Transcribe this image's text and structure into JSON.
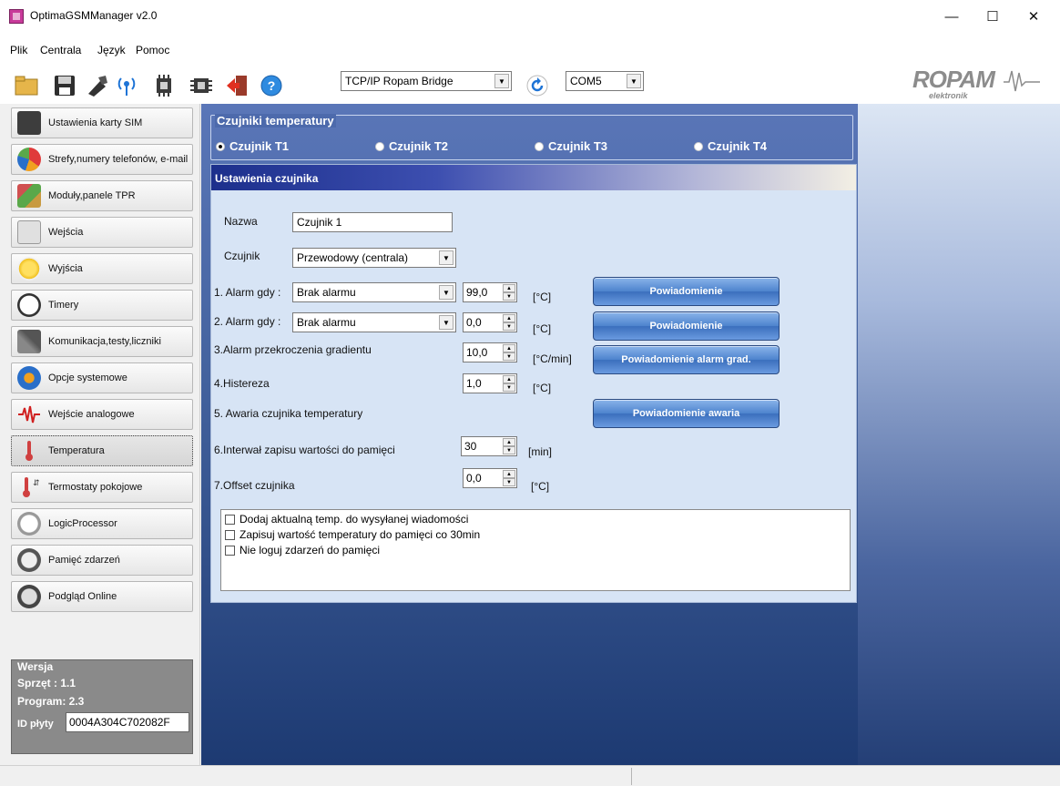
{
  "window": {
    "title": "OptimaGSMManager v2.0"
  },
  "menu": [
    {
      "label": "Plik"
    },
    {
      "label": "Centrala"
    },
    {
      "label": "Język"
    },
    {
      "label": "Pomoc"
    }
  ],
  "toolbar": {
    "connection": "TCP/IP Ropam Bridge",
    "port": "COM5",
    "logo_text": "ROPAM elektronik",
    "icons": [
      "folder-icon",
      "save-icon",
      "tool-icon",
      "wireless-icon",
      "chip-read-icon",
      "chip-write-icon",
      "exit-icon",
      "help-icon",
      "refresh-icon"
    ]
  },
  "sidebar": {
    "items": [
      {
        "label": "Ustawienia karty SIM",
        "icon": "sim-card-icon",
        "color": "#3d3d3d"
      },
      {
        "label": "Strefy,numery telefonów, e-mail",
        "icon": "pie-chart-icon",
        "color": "#e03a3a"
      },
      {
        "label": "Moduły,panele TPR",
        "icon": "modules-icon",
        "color": "#5aa84a"
      },
      {
        "label": "Wejścia",
        "icon": "door-icon",
        "color": "#b5b5b5"
      },
      {
        "label": "Wyjścia",
        "icon": "bulb-icon",
        "color": "#f0c020"
      },
      {
        "label": "Timery",
        "icon": "clock-icon",
        "color": "#404040"
      },
      {
        "label": "Komunikacja,testy,liczniki",
        "icon": "tools-icon",
        "color": "#888"
      },
      {
        "label": "Opcje systemowe",
        "icon": "gears-icon",
        "color": "#2a6fc9"
      },
      {
        "label": "Wejście analogowe",
        "icon": "wave-icon",
        "color": "#d02020"
      },
      {
        "label": "Temperatura",
        "icon": "thermometer-icon",
        "color": "#d04040"
      },
      {
        "label": "Termostaty pokojowe",
        "icon": "thermostat-icon",
        "color": "#d04040"
      },
      {
        "label": "LogicProcessor",
        "icon": "logic-icon",
        "color": "#777"
      },
      {
        "label": "Pamięć zdarzeń",
        "icon": "event-memory-icon",
        "color": "#555"
      },
      {
        "label": "Podgląd Online",
        "icon": "online-preview-icon",
        "color": "#555"
      }
    ],
    "active_index": 9,
    "version": {
      "legend": "Wersja",
      "hardware": "Sprzęt : 1.1",
      "program": "Program: 2.3",
      "id_label": "ID płyty",
      "id_value": "0004A304C702082F"
    }
  },
  "sensors": {
    "legend": "Czujniki temperatury",
    "options": [
      "Czujnik T1",
      "Czujnik T2",
      "Czujnik T3",
      "Czujnik T4"
    ],
    "selected": 0
  },
  "settings": {
    "header": "Ustawienia czujnika",
    "name_label": "Nazwa",
    "name_value": "Czujnik 1",
    "sensor_label": "Czujnik",
    "sensor_value": "Przewodowy (centrala)",
    "alarm1_label": "1. Alarm gdy :",
    "alarm1_value": "Brak alarmu",
    "alarm1_temp": "99,0",
    "alarm1_unit": "[°C]",
    "alarm2_label": "2. Alarm gdy :",
    "alarm2_value": "Brak alarmu",
    "alarm2_temp": "0,0",
    "alarm2_unit": "[°C]",
    "gradient_label": "3.Alarm przekroczenia gradientu",
    "gradient_value": "10,0",
    "gradient_unit": "[°C/min]",
    "hysteresis_label": "4.Histereza",
    "hysteresis_value": "1,0",
    "hysteresis_unit": "[°C]",
    "failure_label": "5. Awaria czujnika temperatury",
    "interval_label": "6.Interwał zapisu wartości do pamięci",
    "interval_value": "30",
    "interval_unit": "[min]",
    "offset_label": "7.Offset czujnika",
    "offset_value": "0,0",
    "offset_unit": "[°C]",
    "btn_notify1": "Powiadomienie",
    "btn_notify2": "Powiadomienie",
    "btn_notify_grad": "Powiadomienie alarm grad.",
    "btn_notify_failure": "Powiadomienie awaria",
    "checkboxes": [
      {
        "label": "Dodaj aktualną temp. do wysyłanej wiadomości",
        "checked": false
      },
      {
        "label": "Zapisuj wartość temperatury do pamięci co 30min",
        "checked": false
      },
      {
        "label": "Nie loguj zdarzeń do pamięci",
        "checked": false
      }
    ]
  }
}
